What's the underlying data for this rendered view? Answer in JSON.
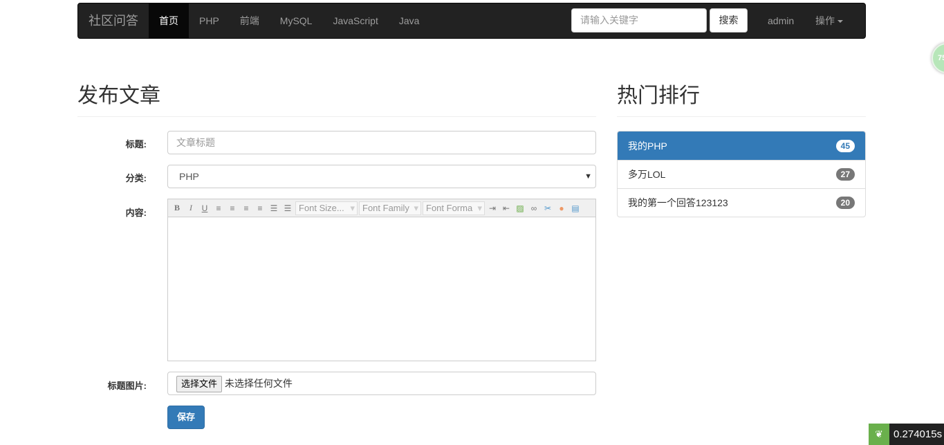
{
  "nav": {
    "brand": "社区问答",
    "items": [
      "首页",
      "PHP",
      "前端",
      "MySQL",
      "JavaScript",
      "Java"
    ],
    "search_placeholder": "请输入关键字",
    "search_button": "搜索",
    "user": "admin",
    "ops": "操作"
  },
  "form": {
    "heading": "发布文章",
    "title_label": "标题:",
    "title_placeholder": "文章标题",
    "category_label": "分类:",
    "category_value": "PHP",
    "content_label": "内容:",
    "toolbar": {
      "font_size": "Font Size...",
      "font_family": "Font Family",
      "font_format": "Font Forma"
    },
    "image_label": "标题图片:",
    "file_button": "选择文件",
    "file_status": "未选择任何文件",
    "save": "保存"
  },
  "hot": {
    "heading": "热门排行",
    "items": [
      {
        "label": "我的PHP",
        "count": "45"
      },
      {
        "label": "多万LOL",
        "count": "27"
      },
      {
        "label": "我的第一个回答123123",
        "count": "20"
      }
    ]
  },
  "widget": {
    "circle": "75",
    "time": "0.274015s"
  }
}
